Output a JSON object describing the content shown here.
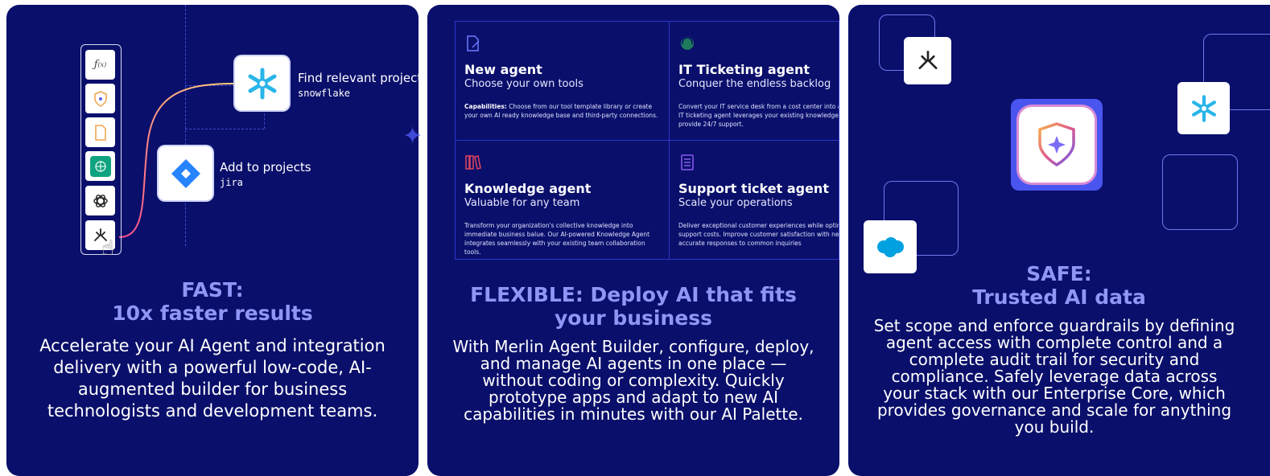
{
  "colors": {
    "card_background": "#0a0f6b",
    "heading": "#8f96f5",
    "accent_blue": "#3e49d6",
    "snowflake": "#29b5e8",
    "jira": "#2684ff",
    "salesforce": "#00a1e0"
  },
  "fast": {
    "heading_line1": "FAST:",
    "heading_line2": "10x faster results",
    "body": "Accelerate your AI Agent and integration delivery with a powerful low-code, AI-augmented builder for business technologists and development teams.",
    "flow_nodes": [
      {
        "title": "Find relevant projects",
        "subtitle": "snowflake",
        "icon": "snowflake-icon"
      },
      {
        "title": "Add to projects",
        "subtitle": "jira",
        "icon": "jira-icon"
      }
    ],
    "tool_rail": [
      "function-icon",
      "shield-icon",
      "document-icon",
      "brain-icon",
      "openai-icon",
      "merlin-icon"
    ]
  },
  "flexible": {
    "heading": "FLEXIBLE: Deploy AI that fits your business",
    "body": "With Merlin Agent Builder, configure, deploy, and manage AI agents in one place — without coding or complexity. Quickly prototype apps and adapt to new AI capabilities in minutes with our AI Palette.",
    "agents": [
      {
        "name": "New agent",
        "tagline": "Choose your own tools",
        "capabilities_label": "Capabilities:",
        "description": "Choose from our tool template library or create your own AI ready knowledge base and third-party connections.",
        "icon": "document-edit-icon"
      },
      {
        "name": "IT Ticketing agent",
        "tagline": "Conquer the endless backlog",
        "capabilities_label": "",
        "description": "Convert your IT service desk from a cost center into a driver. Our IT ticketing agent leverages your existing knowledge base to provide 24/7 support.",
        "icon": "headset-icon"
      },
      {
        "name": "Knowledge agent",
        "tagline": "Valuable for any team",
        "capabilities_label": "",
        "description": "Transform your organization's collective knowledge into immediate business balue. Our AI-powered Knowledge Agent integrates seamlessly with your existing team collaboration tools.",
        "icon": "books-icon"
      },
      {
        "name": "Support ticket agent",
        "tagline": "Scale your operations",
        "capabilities_label": "",
        "description": "Deliver exceptional customer experiences while optimizing support costs. Improve customer satisfaction with near instant, accurate responses to common inquiries",
        "icon": "list-icon"
      }
    ]
  },
  "safe": {
    "heading_line1": "SAFE:",
    "heading_line2": "Trusted AI data",
    "body": "Set scope and enforce guardrails by defining agent access with complete control and a complete audit trail for security and compliance. Safely leverage data across your stack with our Enterprise Core, which provides governance and scale for anything you build.",
    "tiles": [
      "merlin-icon",
      "snowflake-icon",
      "salesforce-icon",
      "shield-sparkle-icon"
    ]
  }
}
